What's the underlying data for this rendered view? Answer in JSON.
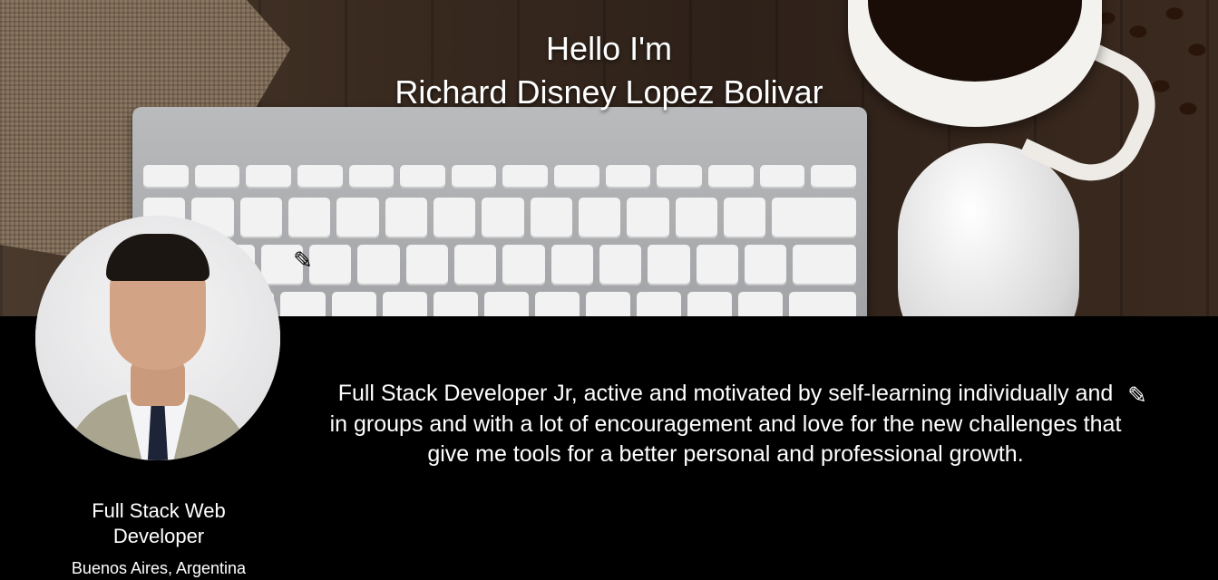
{
  "hero": {
    "greeting": "Hello I'm",
    "name": "Richard Disney Lopez Bolivar",
    "edit_icon": "pencil-icon"
  },
  "profile": {
    "avatar": "profile-photo",
    "role": "Full Stack Web Developer",
    "location": "Buenos Aires, Argentina"
  },
  "about": {
    "text": "Full Stack Developer Jr, active and motivated by self-learning individually and in groups and with a lot of encouragement and love for the new challenges that give me tools for a better personal and professional growth.",
    "edit_icon": "pencil-icon"
  },
  "colors": {
    "background": "#000000",
    "text": "#ffffff"
  }
}
